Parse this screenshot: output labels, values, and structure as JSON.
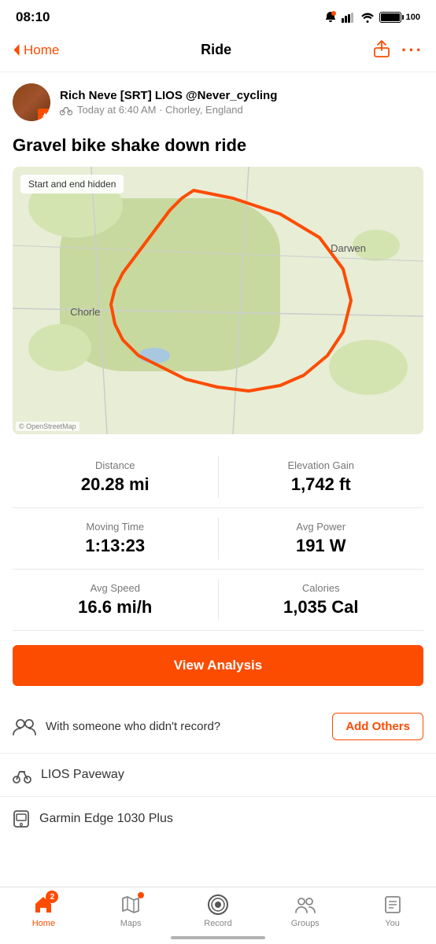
{
  "statusBar": {
    "time": "08:10",
    "batteryLevel": "100"
  },
  "header": {
    "backLabel": "Home",
    "title": "Ride"
  },
  "user": {
    "name": "Rich Neve [SRT] LIOS @Never_cycling",
    "meta": "Today at 6:40 AM · Chorley, England"
  },
  "activity": {
    "title": "Gravel bike shake down ride",
    "mapLabel": "Start and end hidden",
    "mapPlaces": {
      "darwen": "Darwen",
      "chorley": "Chorle"
    }
  },
  "stats": {
    "distance": {
      "label": "Distance",
      "value": "20.28 mi"
    },
    "elevationGain": {
      "label": "Elevation Gain",
      "value": "1,742 ft"
    },
    "movingTime": {
      "label": "Moving Time",
      "value": "1:13:23"
    },
    "avgPower": {
      "label": "Avg Power",
      "value": "191 W"
    },
    "avgSpeed": {
      "label": "Avg Speed",
      "value": "16.6 mi/h"
    },
    "calories": {
      "label": "Calories",
      "value": "1,035 Cal"
    }
  },
  "buttons": {
    "viewAnalysis": "View Analysis",
    "addOthers": "Add Others"
  },
  "addOthers": {
    "text": "With someone who didn't record?"
  },
  "route": {
    "name": "LIOS Paveway"
  },
  "device": {
    "name": "Garmin Edge 1030 Plus"
  },
  "tabBar": {
    "items": [
      {
        "label": "Home",
        "active": true,
        "badge": "2"
      },
      {
        "label": "Maps",
        "active": false,
        "dot": true
      },
      {
        "label": "Record",
        "active": false
      },
      {
        "label": "Groups",
        "active": false
      },
      {
        "label": "You",
        "active": false
      }
    ]
  }
}
